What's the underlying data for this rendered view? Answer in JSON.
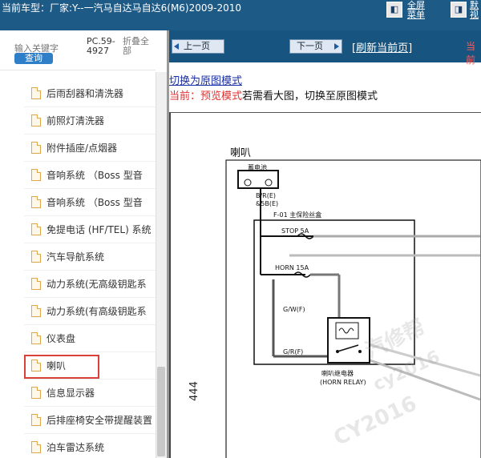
{
  "header": {
    "vehicle_label": "当前车型：",
    "vehicle_value": "厂家:Y--一汽马自达马自达6(M6)2009-2010",
    "fullscreen_label": "全屏\n菜单",
    "default_view_label": "默\n视"
  },
  "sidebar": {
    "search_placeholder": "输入关键字",
    "search_button": "查询",
    "pc_code": "PC.59-4927",
    "collapse_all": "折叠全部",
    "items": [
      {
        "label": "后雨刮器和清洗器"
      },
      {
        "label": "前照灯清洗器"
      },
      {
        "label": "附件插座/点烟器"
      },
      {
        "label": "音响系统 （Boss 型音"
      },
      {
        "label": "音响系统 （Boss 型音"
      },
      {
        "label": "免提电话 (HF/TEL) 系统"
      },
      {
        "label": "汽车导航系统"
      },
      {
        "label": "动力系统(无高级钥匙系"
      },
      {
        "label": "动力系统(有高级钥匙系"
      },
      {
        "label": "仪表盘"
      },
      {
        "label": "喇叭"
      },
      {
        "label": "信息显示器"
      },
      {
        "label": "后排座椅安全带提醒装置"
      },
      {
        "label": "泊车雷达系统"
      }
    ],
    "selected_index": 10
  },
  "toolbar": {
    "prev_label": "上一页",
    "next_label": "下一页",
    "refresh_label": "[刷新当前页]",
    "current_prefix": "当前"
  },
  "content": {
    "switch_link": "切换为原图模式",
    "current_mode_red": "当前：预览模式",
    "current_mode_black": "若需看大图，切换至原图模式",
    "page_number": "444",
    "diagram_title": "喇叭"
  },
  "diagram": {
    "battery_label": "蓄电池",
    "wire_top": "B/R(E)",
    "wire_top2": "&5B(E)",
    "main_fuse": "F-01 主保险丝盒",
    "fuse_stop": "STOP 5A",
    "fuse_horn": "HORN 15A",
    "wire_gw": "G/W(F)",
    "wire_gr": "G/R(F)",
    "relay_cn": "喇叭继电器",
    "relay_en": "(HORN RELAY)"
  },
  "watermark": {
    "line1": "汽修帮",
    "line2": "cy2016",
    "line3": "CY2016"
  },
  "colors": {
    "header_bg": "#1e5a86",
    "nav_bg": "#17547f",
    "selected_border": "#d9403a",
    "link": "#1a2fa3",
    "red_text": "#e03030"
  }
}
